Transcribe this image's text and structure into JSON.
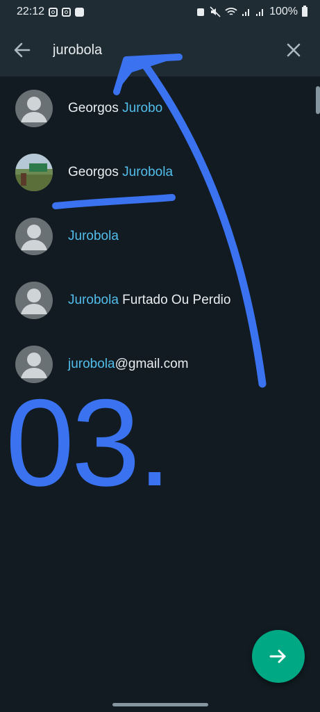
{
  "status_bar": {
    "time": "22:12",
    "battery": "100%"
  },
  "search": {
    "value": "jurobola",
    "icons": {
      "back": "arrow-left-icon",
      "clear": "close-icon"
    }
  },
  "contacts": [
    {
      "prefix": "Georgos ",
      "match": "Jurobo",
      "suffix": "",
      "avatar": "default-avatar"
    },
    {
      "prefix": "Georgos ",
      "match": "Jurobola",
      "suffix": "",
      "avatar": "photo-avatar"
    },
    {
      "prefix": "",
      "match": "Jurobola",
      "suffix": "",
      "avatar": "default-avatar"
    },
    {
      "prefix": "",
      "match": "Jurobola",
      "suffix": " Furtado Ou Perdio",
      "avatar": "default-avatar"
    },
    {
      "prefix": "",
      "match": "jurobola",
      "suffix": "@gmail.com",
      "avatar": "default-avatar"
    }
  ],
  "annotation": {
    "step_label": "03.",
    "color": "#3a72f0"
  },
  "fab": {
    "icon": "arrow-right-icon"
  },
  "colors": {
    "background": "#111b21",
    "header": "#1f2c34",
    "highlight": "#53bdeb",
    "accent": "#00a884"
  }
}
